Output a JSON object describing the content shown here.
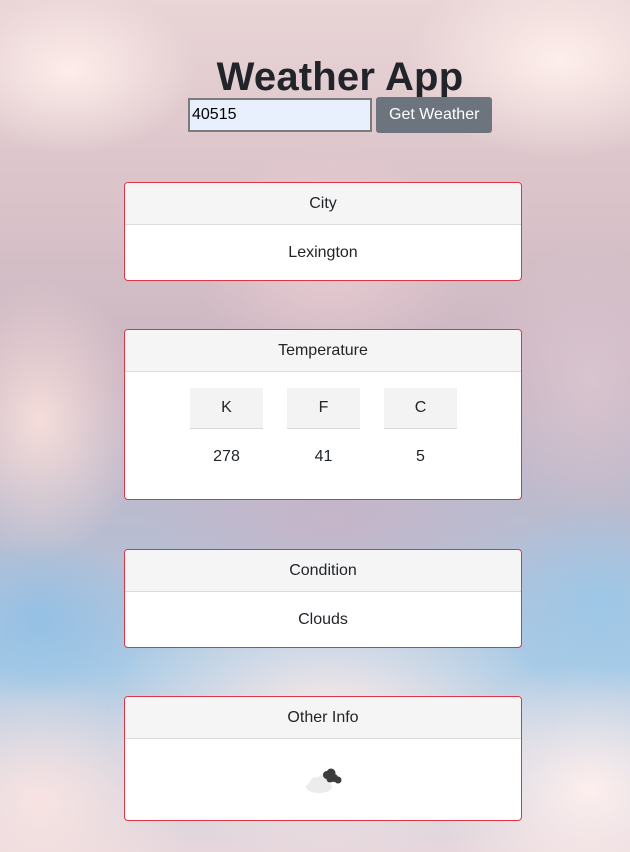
{
  "app": {
    "title": "Weather App"
  },
  "search": {
    "value": "40515",
    "button_label": "Get Weather"
  },
  "city_card": {
    "header": "City",
    "value": "Lexington"
  },
  "temperature_card": {
    "header": "Temperature",
    "columns": [
      {
        "unit": "K",
        "value": "278"
      },
      {
        "unit": "F",
        "value": "41"
      },
      {
        "unit": "C",
        "value": "5"
      }
    ]
  },
  "condition_card": {
    "header": "Condition",
    "value": "Clouds"
  },
  "other_card": {
    "header": "Other Info",
    "icon": "clouds-icon"
  },
  "colors": {
    "card_border": "#dc3545",
    "button_bg": "#6c757d",
    "input_bg": "#e8f0fe"
  }
}
